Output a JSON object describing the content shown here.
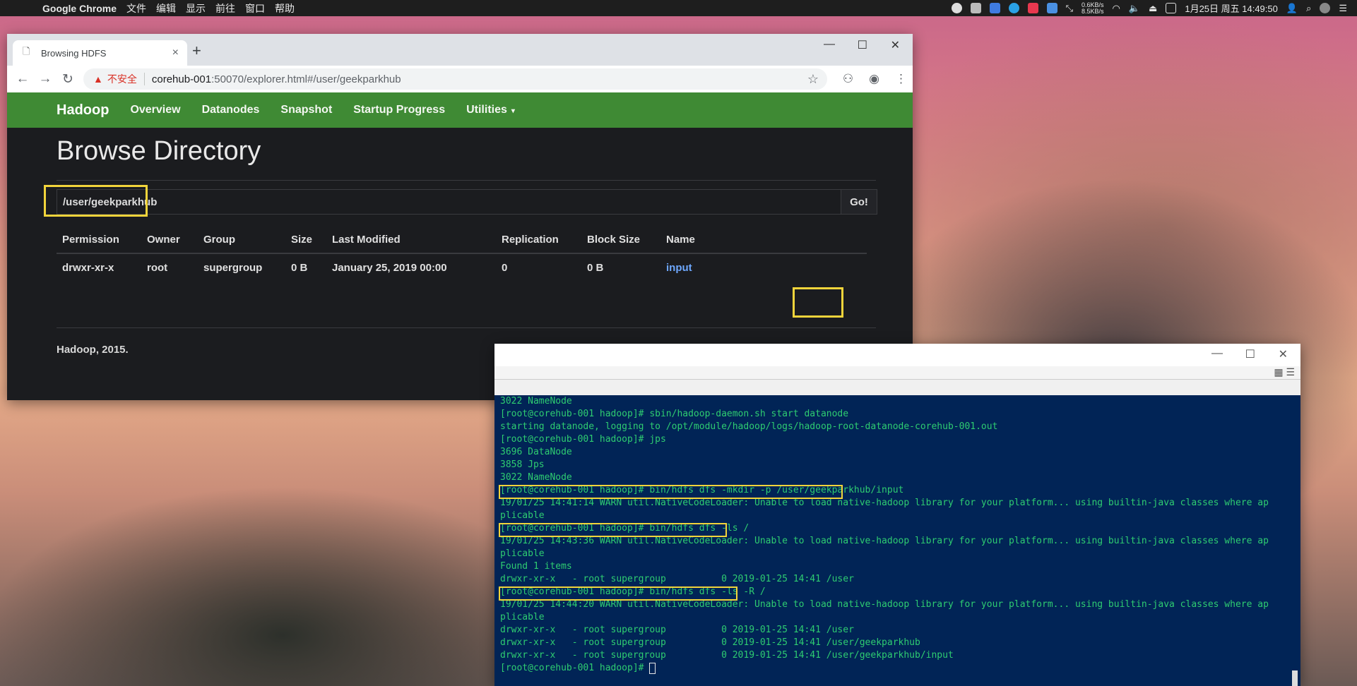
{
  "menubar": {
    "app_name": "Google Chrome",
    "menus": [
      "文件",
      "编辑",
      "显示",
      "前往",
      "窗口",
      "帮助"
    ],
    "net_up": "0.6KB/s",
    "net_down": "8.5KB/s",
    "datetime": "1月25日 周五 14:49:50"
  },
  "browser": {
    "tab_title": "Browsing HDFS",
    "insecure_label": "不安全",
    "url_host": "corehub-001",
    "url_path": ":50070/explorer.html#/user/geekparkhub"
  },
  "hadoop": {
    "brand": "Hadoop",
    "nav": [
      "Overview",
      "Datanodes",
      "Snapshot",
      "Startup Progress",
      "Utilities"
    ],
    "heading": "Browse Directory",
    "path_value": "/user/geekparkhub",
    "go_label": "Go!",
    "columns": [
      "Permission",
      "Owner",
      "Group",
      "Size",
      "Last Modified",
      "Replication",
      "Block Size",
      "Name"
    ],
    "rows": [
      {
        "permission": "drwxr-xr-x",
        "owner": "root",
        "group": "supergroup",
        "size": "0 B",
        "modified": "January 25, 2019 00:00",
        "replication": "0",
        "block_size": "0 B",
        "name": "input"
      }
    ],
    "footer": "Hadoop, 2015."
  },
  "terminal": {
    "lines": [
      "3022 NameNode",
      "[root@corehub-001 hadoop]# sbin/hadoop-daemon.sh start datanode",
      "starting datanode, logging to /opt/module/hadoop/logs/hadoop-root-datanode-corehub-001.out",
      "[root@corehub-001 hadoop]# jps",
      "3696 DataNode",
      "3858 Jps",
      "3022 NameNode",
      "[root@corehub-001 hadoop]# bin/hdfs dfs -mkdir -p /user/geekparkhub/input",
      "19/01/25 14:41:14 WARN util.NativeCodeLoader: Unable to load native-hadoop library for your platform... using builtin-java classes where ap",
      "plicable",
      "[root@corehub-001 hadoop]# bin/hdfs dfs -ls /",
      "19/01/25 14:43:36 WARN util.NativeCodeLoader: Unable to load native-hadoop library for your platform... using builtin-java classes where ap",
      "plicable",
      "Found 1 items",
      "drwxr-xr-x   - root supergroup          0 2019-01-25 14:41 /user",
      "[root@corehub-001 hadoop]# bin/hdfs dfs -ls -R /",
      "19/01/25 14:44:20 WARN util.NativeCodeLoader: Unable to load native-hadoop library for your platform... using builtin-java classes where ap",
      "plicable",
      "drwxr-xr-x   - root supergroup          0 2019-01-25 14:41 /user",
      "drwxr-xr-x   - root supergroup          0 2019-01-25 14:41 /user/geekparkhub",
      "drwxr-xr-x   - root supergroup          0 2019-01-25 14:41 /user/geekparkhub/input",
      "[root@corehub-001 hadoop]# "
    ]
  }
}
